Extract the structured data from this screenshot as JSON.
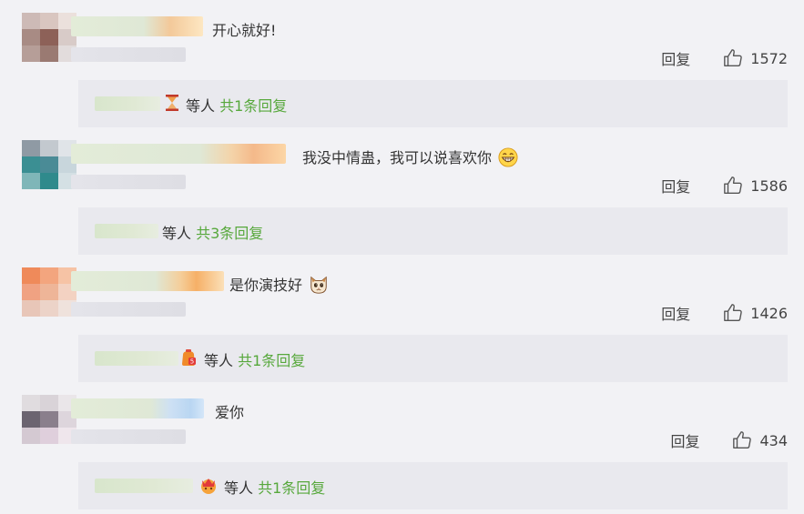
{
  "comments": [
    {
      "text": "开心就好!",
      "reply_label": "回复",
      "likes": "1572",
      "replies_who": "等人",
      "replies_count": "共1条回复"
    },
    {
      "text": "我没中情蛊，我可以说喜欢你",
      "reply_label": "回复",
      "likes": "1586",
      "replies_who": "等人",
      "replies_count": "共3条回复"
    },
    {
      "text": "是你演技好",
      "reply_label": "回复",
      "likes": "1426",
      "replies_who": "等人",
      "replies_count": "共1条回复"
    },
    {
      "text": "爱你",
      "reply_label": "回复",
      "likes": "434",
      "replies_who": "等人",
      "replies_count": "共1条回复"
    }
  ],
  "icons": {
    "like": "thumbs-up-icon",
    "grin_emoji": "grinning-face-icon",
    "cat_emoji": "cat-face-icon",
    "hourglass": "hourglass-icon"
  },
  "colors": {
    "reply_count_green": "#57a83c",
    "page_bg": "#f2f2f5",
    "reply_box_bg": "#e9e9ee"
  }
}
